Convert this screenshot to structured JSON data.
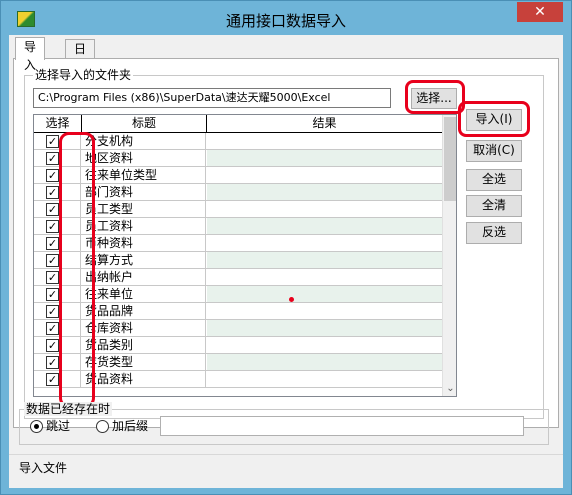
{
  "window": {
    "title": "通用接口数据导入",
    "close_label": "✕"
  },
  "tabs": [
    {
      "label": "导入",
      "active": true
    },
    {
      "label": "日志",
      "active": false
    }
  ],
  "folder": {
    "group_label": "选择导入的文件夹",
    "path_value": "C:\\Program Files (x86)\\SuperData\\速达天耀5000\\Excel",
    "browse_label": "选择..."
  },
  "grid": {
    "columns": [
      "选择",
      "标题",
      "结果"
    ],
    "rows": [
      {
        "checked": true,
        "title": "分支机构",
        "result": ""
      },
      {
        "checked": true,
        "title": "地区资料",
        "result": ""
      },
      {
        "checked": true,
        "title": "往来单位类型",
        "result": ""
      },
      {
        "checked": true,
        "title": "部门资料",
        "result": ""
      },
      {
        "checked": true,
        "title": "员工类型",
        "result": ""
      },
      {
        "checked": true,
        "title": "员工资料",
        "result": ""
      },
      {
        "checked": true,
        "title": "币种资料",
        "result": ""
      },
      {
        "checked": true,
        "title": "结算方式",
        "result": ""
      },
      {
        "checked": true,
        "title": "出纳帐户",
        "result": ""
      },
      {
        "checked": true,
        "title": "往来单位",
        "result": ""
      },
      {
        "checked": true,
        "title": "货品品牌",
        "result": ""
      },
      {
        "checked": true,
        "title": "仓库资料",
        "result": ""
      },
      {
        "checked": true,
        "title": "货品类别",
        "result": ""
      },
      {
        "checked": true,
        "title": "存货类型",
        "result": ""
      },
      {
        "checked": true,
        "title": "货品资料",
        "result": ""
      }
    ],
    "checkmark": "✓",
    "scroll_down_icon": "chevron-down-icon"
  },
  "actions": {
    "import_label": "导入(I)",
    "cancel_label": "取消(C)",
    "select_all_label": "全选",
    "clear_all_label": "全清",
    "invert_label": "反选"
  },
  "existing": {
    "group_label": "数据已经存在时",
    "skip_label": "跳过",
    "append_label": "加后缀",
    "selected": "skip"
  },
  "status": {
    "label": "导入文件"
  },
  "colors": {
    "title_bar": "#6eb4d8",
    "close_button": "#c7413b",
    "annotation_red": "#e8001c"
  }
}
